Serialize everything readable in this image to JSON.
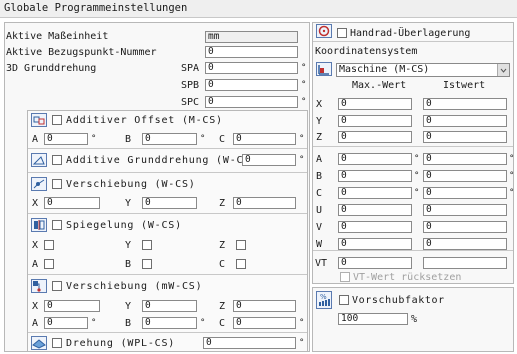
{
  "title": "Globale Programmeinstellungen",
  "units": {
    "label": "Aktive Maßeinheit",
    "value": "mm"
  },
  "ref_point": {
    "label": "Aktive Bezugspunkt-Nummer",
    "value": "0"
  },
  "rot3d": {
    "label": "3D Grunddrehung",
    "spa_label": "SPA",
    "spa": "0",
    "spb_label": "SPB",
    "spb": "0",
    "spc_label": "SPC",
    "spc": "0"
  },
  "deg": "°",
  "add_offset": {
    "label": "Additiver Offset (M-CS)",
    "a_label": "A",
    "a": "0",
    "b_label": "B",
    "b": "0",
    "c_label": "C",
    "c": "0"
  },
  "add_rot": {
    "label": "Additive Grunddrehung (W-CS)",
    "value": "0"
  },
  "shift": {
    "label": "Verschiebung (W-CS)",
    "x_label": "X",
    "x": "0",
    "y_label": "Y",
    "y": "0",
    "z_label": "Z",
    "z": "0"
  },
  "mirror": {
    "label": "Spiegelung (W-CS)",
    "x_label": "X",
    "y_label": "Y",
    "z_label": "Z",
    "a_label": "A",
    "b_label": "B",
    "c_label": "C"
  },
  "shift_mw": {
    "label": "Verschiebung (mW-CS)",
    "x_label": "X",
    "x": "0",
    "y_label": "Y",
    "y": "0",
    "z_label": "Z",
    "z": "0",
    "a_label": "A",
    "a": "0",
    "b_label": "B",
    "b": "0",
    "c_label": "C",
    "c": "0"
  },
  "wpl_rot": {
    "label": "Drehung (WPL-CS)",
    "value": "0"
  },
  "handwheel": {
    "label": "Handrad-Überlagerung"
  },
  "coord": {
    "label": "Koordinatensystem",
    "selected": "Maschine (M-CS)",
    "col_max": "Max.-Wert",
    "col_actual": "Istwert"
  },
  "axes": [
    {
      "name": "X",
      "max": "0",
      "act": "0"
    },
    {
      "name": "Y",
      "max": "0",
      "act": "0"
    },
    {
      "name": "Z",
      "max": "0",
      "act": "0"
    },
    {
      "name": "A",
      "max": "0",
      "act": "0"
    },
    {
      "name": "B",
      "max": "0",
      "act": "0"
    },
    {
      "name": "C",
      "max": "0",
      "act": "0"
    },
    {
      "name": "U",
      "max": "0",
      "act": "0"
    },
    {
      "name": "V",
      "max": "0",
      "act": "0"
    },
    {
      "name": "W",
      "max": "0",
      "act": "0"
    }
  ],
  "vt": {
    "label": "VT",
    "value": "0",
    "reset_label": "VT-Wert rücksetzen"
  },
  "feed": {
    "label": "Vorschubfaktor",
    "value": "100",
    "unit": "%"
  }
}
